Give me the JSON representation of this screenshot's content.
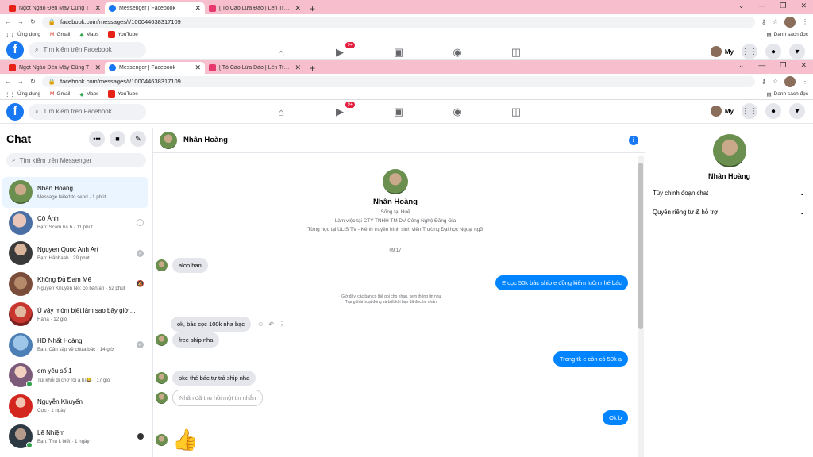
{
  "browser": {
    "tabs": [
      {
        "title": "Ngọt Ngào Đến Mấy Cũng T",
        "icon": "youtube-icon",
        "active": false
      },
      {
        "title": "Messenger | Facebook",
        "icon": "facebook-icon",
        "active": true
      },
      {
        "title": "[ Tố Cáo Lừa Đảo | Lên Trung Tâ",
        "icon": "page-icon",
        "active": false
      }
    ],
    "url": "facebook.com/messages/t/100044638317109",
    "bookmarks": [
      "Ứng dụng",
      "Gmail",
      "Maps",
      "YouTube"
    ],
    "reading_list": "Danh sách đọc"
  },
  "fb_nav": {
    "search_placeholder": "Tìm kiếm trên Facebook",
    "watch_badge": "9+",
    "me_label": "My"
  },
  "chat_sidebar": {
    "title": "Chat",
    "search_placeholder": "Tìm kiếm trên Messenger",
    "conversations": [
      {
        "name": "Nhân Hoàng",
        "preview": "Message failed to send · 1 phút"
      },
      {
        "name": "Cô Ảnh",
        "preview": "Bạn: Scam hả b · 11 phút"
      },
      {
        "name": "Nguyen Quoc Anh Art",
        "preview": "Bạn: Hâhhaah · 29 phút"
      },
      {
        "name": "Không Đủ Đam Mê",
        "preview": "Nguyễn Khuyến Nồ: có bán ăn · 52 phút"
      },
      {
        "name": "Ủ vậy móm biết làm sao bây giờ ...",
        "preview": "Haha · 12 giờ"
      },
      {
        "name": "HD Nhất Hoàng",
        "preview": "Bạn: Cân sập về chưa bác · 14 giờ"
      },
      {
        "name": "em yêu số 1",
        "preview": "Túi khổi đi chơ rồi a hì😂 · 17 giờ"
      },
      {
        "name": "Nguyễn Khuyến",
        "preview": "Cực · 1 ngày"
      },
      {
        "name": "Lê Nhiệm",
        "preview": "Bạn: Thu k biết · 1 ngày"
      }
    ]
  },
  "conversation": {
    "name": "Nhân Hoàng",
    "profile_lines": [
      "Sống tại Huế",
      "Làm việc tại CTY TNHH TM DV Công Nghệ Đăng Gia",
      "Từng học tại ULIS TV - Kênh truyền hình sinh viên Trường Đại học Ngoại ngữ"
    ],
    "timestamp": "09:17",
    "messages": {
      "m1": "aloo ban",
      "m2": "E cọc 50k bác ship e đồng kiểm luôn nhé bác",
      "system_note": "Giờ đây, các bạn có thể gọi cho nhau, xem thông tin như Trạng thái hoạt động và biết khi bạn đã đọc tin nhắn.",
      "m3": "ok, bác cọc 100k nha bạc",
      "m4": "free ship nha",
      "m5": "Trong tk e còn có 50k ạ",
      "m6": "oke thé bác tự trả ship nha",
      "m7": "Nhân đã thu hồi một tin nhắn",
      "m8": "Ok b"
    }
  },
  "right_panel": {
    "name": "Nhân Hoàng",
    "items": [
      "Tùy chỉnh đoạn chat",
      "Quyền riêng tư & hỗ trợ"
    ]
  }
}
